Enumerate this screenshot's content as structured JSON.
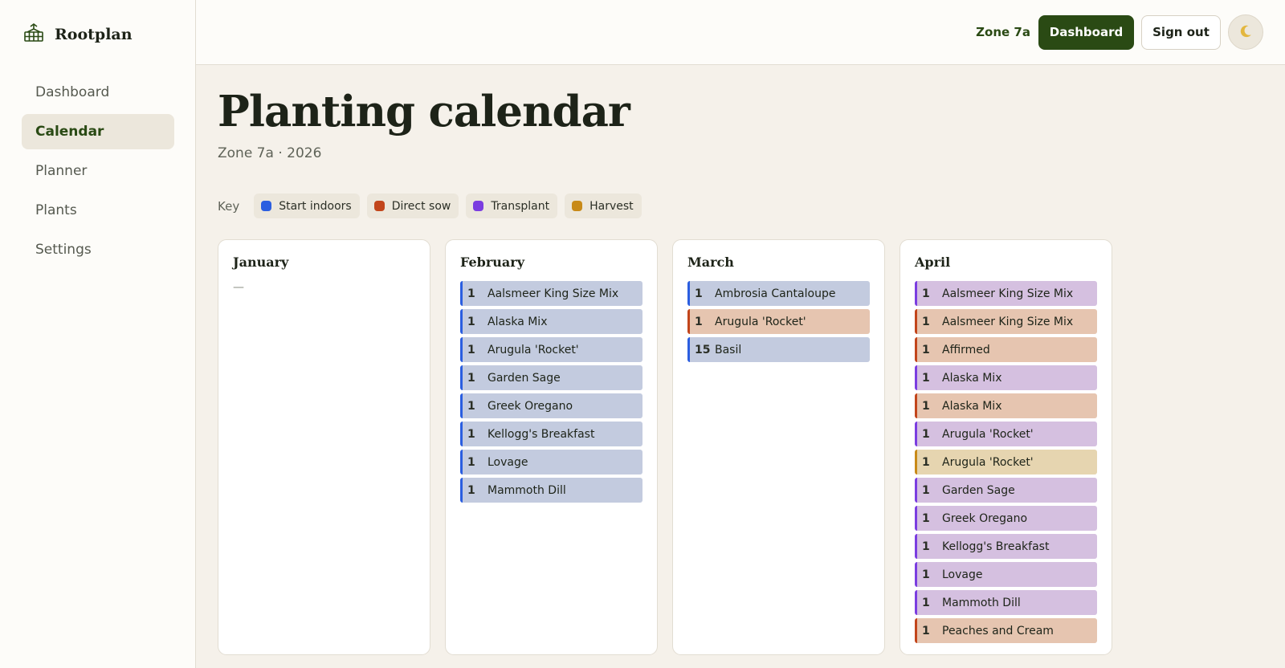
{
  "app": {
    "name": "Rootplan"
  },
  "nav": {
    "items": [
      {
        "label": "Dashboard",
        "active": false
      },
      {
        "label": "Calendar",
        "active": true
      },
      {
        "label": "Planner",
        "active": false
      },
      {
        "label": "Plants",
        "active": false
      },
      {
        "label": "Settings",
        "active": false
      }
    ]
  },
  "topbar": {
    "zone": "Zone 7a",
    "dashboard_label": "Dashboard",
    "signout_label": "Sign out",
    "theme_icon": "moon-icon"
  },
  "page": {
    "title": "Planting calendar",
    "subtitle": "Zone 7a · 2026"
  },
  "legend": {
    "label": "Key",
    "items": [
      {
        "label": "Start indoors",
        "type": "start",
        "color": "#2b5ee0"
      },
      {
        "label": "Direct sow",
        "type": "direct",
        "color": "#c2451b"
      },
      {
        "label": "Transplant",
        "type": "transplant",
        "color": "#7b3de0"
      },
      {
        "label": "Harvest",
        "type": "harvest",
        "color": "#c88a18"
      }
    ]
  },
  "months": [
    {
      "name": "January",
      "empty_text": "—",
      "entries": []
    },
    {
      "name": "February",
      "entries": [
        {
          "day": "1",
          "plant": "Aalsmeer King Size Mix",
          "type": "start"
        },
        {
          "day": "1",
          "plant": "Alaska Mix",
          "type": "start"
        },
        {
          "day": "1",
          "plant": "Arugula 'Rocket'",
          "type": "start"
        },
        {
          "day": "1",
          "plant": "Garden Sage",
          "type": "start"
        },
        {
          "day": "1",
          "plant": "Greek Oregano",
          "type": "start"
        },
        {
          "day": "1",
          "plant": "Kellogg's Breakfast",
          "type": "start"
        },
        {
          "day": "1",
          "plant": "Lovage",
          "type": "start"
        },
        {
          "day": "1",
          "plant": "Mammoth Dill",
          "type": "start"
        }
      ]
    },
    {
      "name": "March",
      "entries": [
        {
          "day": "1",
          "plant": "Ambrosia Cantaloupe",
          "type": "start"
        },
        {
          "day": "1",
          "plant": "Arugula 'Rocket'",
          "type": "direct"
        },
        {
          "day": "15",
          "plant": "Basil",
          "type": "start"
        }
      ]
    },
    {
      "name": "April",
      "entries": [
        {
          "day": "1",
          "plant": "Aalsmeer King Size Mix",
          "type": "transplant"
        },
        {
          "day": "1",
          "plant": "Aalsmeer King Size Mix",
          "type": "direct"
        },
        {
          "day": "1",
          "plant": "Affirmed",
          "type": "direct"
        },
        {
          "day": "1",
          "plant": "Alaska Mix",
          "type": "transplant"
        },
        {
          "day": "1",
          "plant": "Alaska Mix",
          "type": "direct"
        },
        {
          "day": "1",
          "plant": "Arugula 'Rocket'",
          "type": "transplant"
        },
        {
          "day": "1",
          "plant": "Arugula 'Rocket'",
          "type": "harvest"
        },
        {
          "day": "1",
          "plant": "Garden Sage",
          "type": "transplant"
        },
        {
          "day": "1",
          "plant": "Greek Oregano",
          "type": "transplant"
        },
        {
          "day": "1",
          "plant": "Kellogg's Breakfast",
          "type": "transplant"
        },
        {
          "day": "1",
          "plant": "Lovage",
          "type": "transplant"
        },
        {
          "day": "1",
          "plant": "Mammoth Dill",
          "type": "transplant"
        },
        {
          "day": "1",
          "plant": "Peaches and Cream",
          "type": "direct"
        }
      ]
    }
  ]
}
